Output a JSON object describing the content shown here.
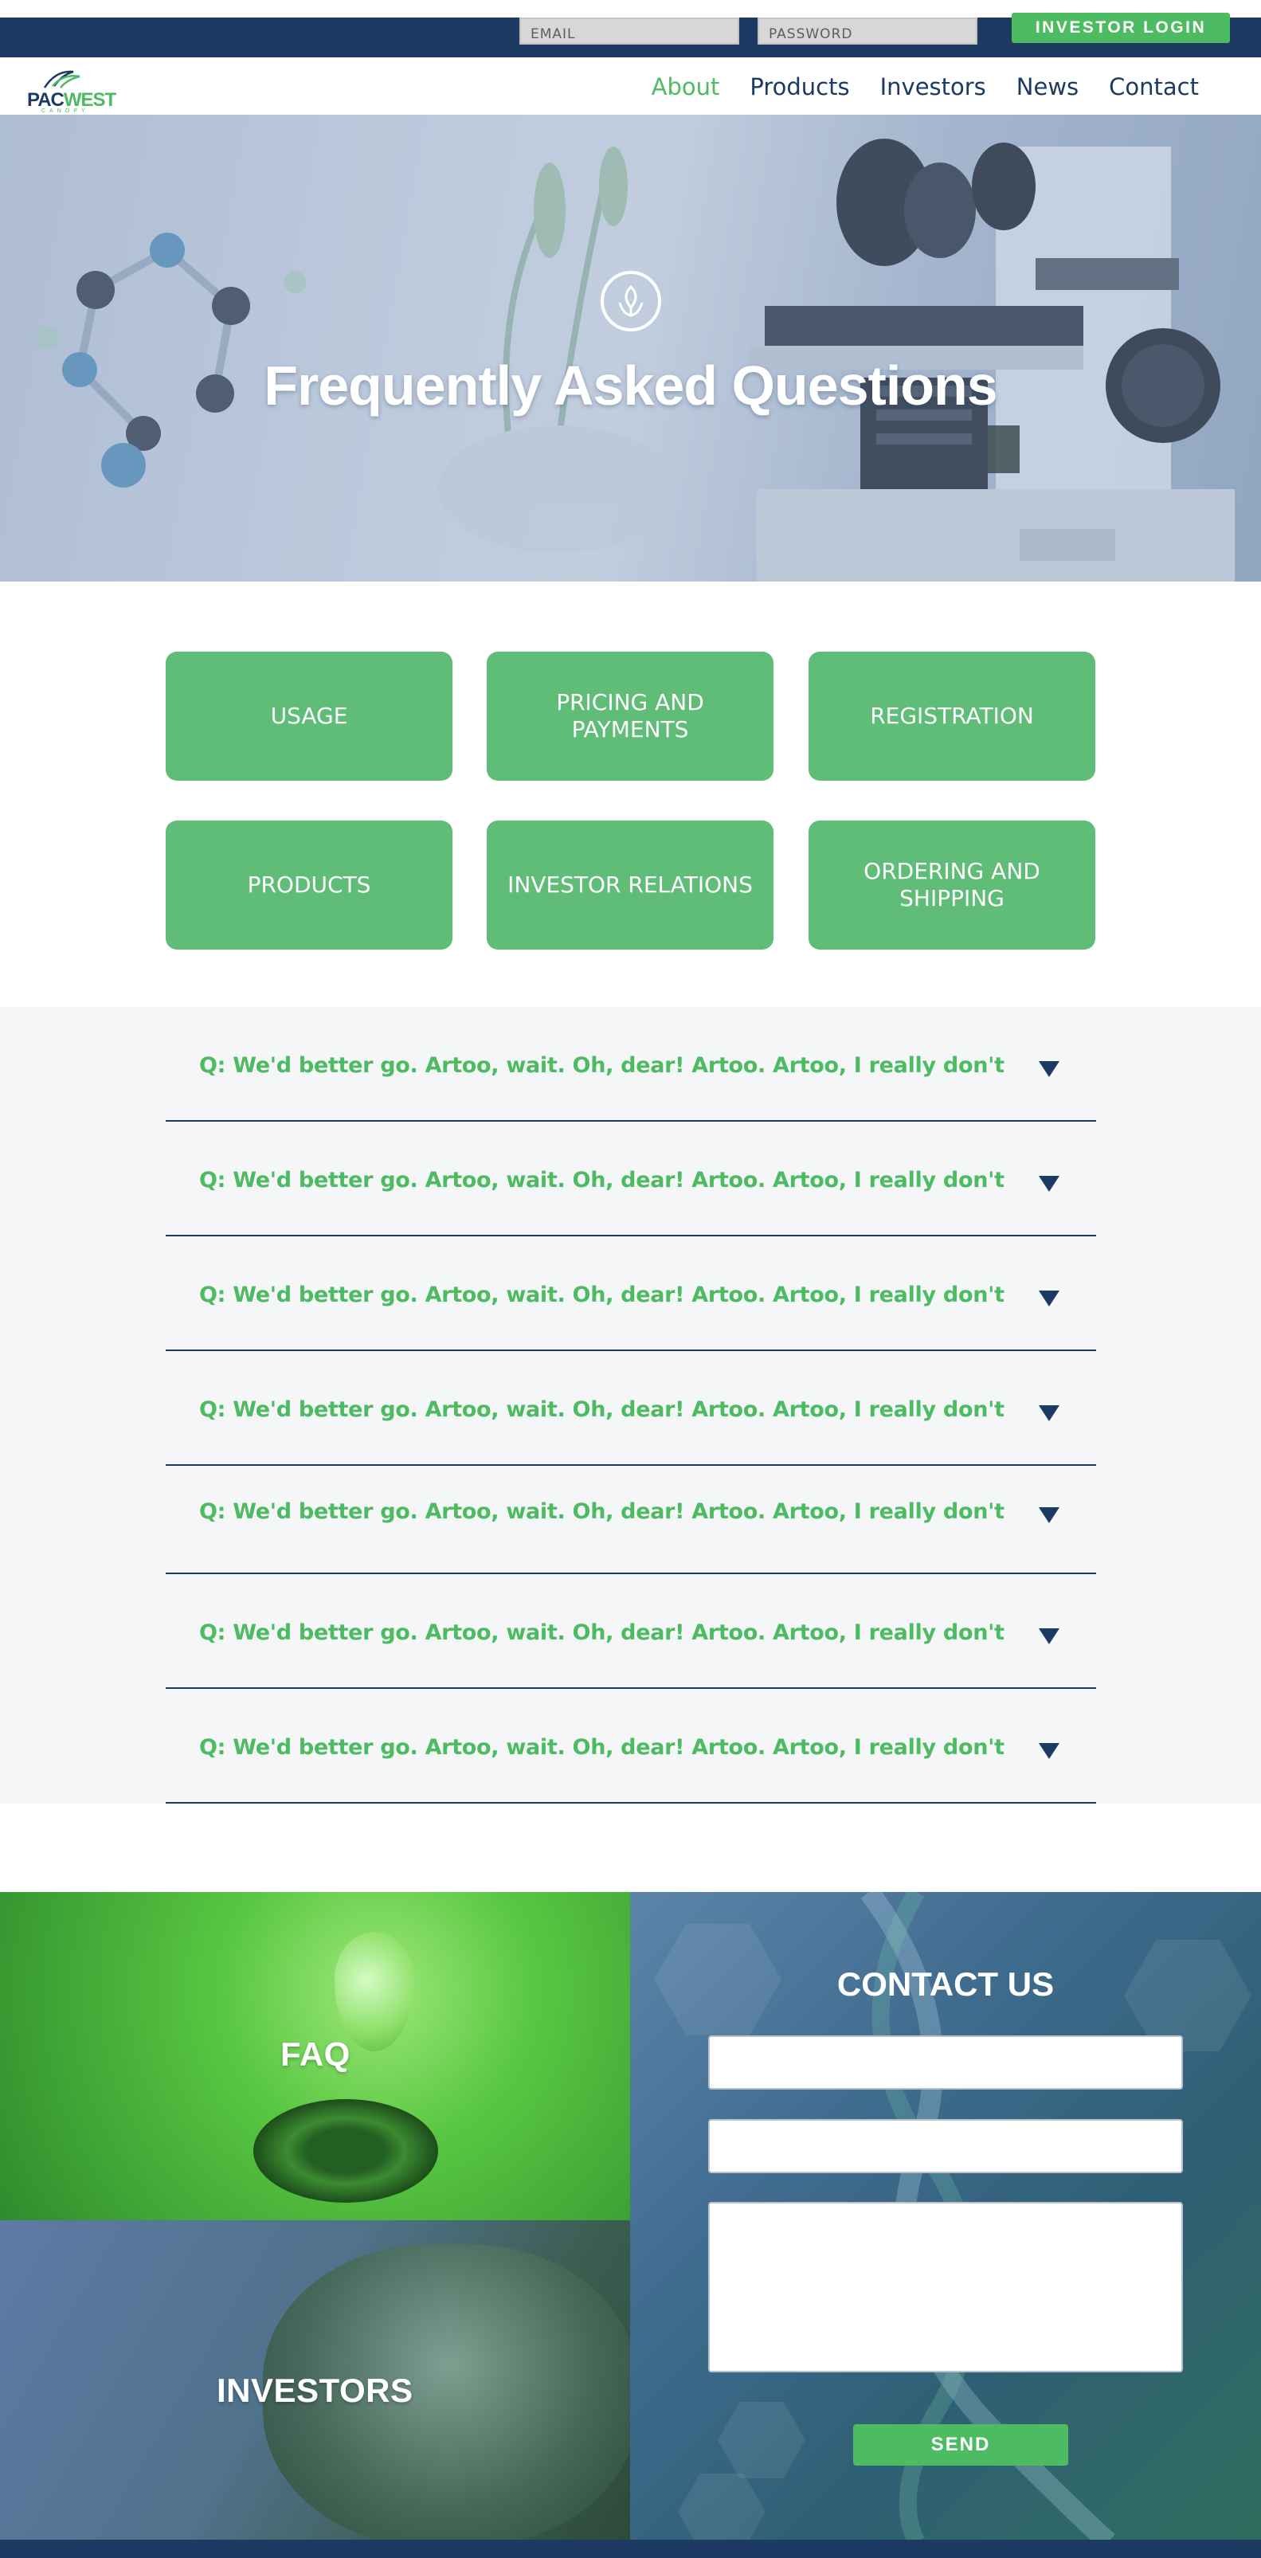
{
  "topbar": {
    "email_placeholder": "EMAIL",
    "password_placeholder": "PASSWORD",
    "login_label": "INVESTOR LOGIN"
  },
  "brand": {
    "logo_pac": "PAC",
    "logo_west": "WEST",
    "logo_sub": "CANOPY"
  },
  "nav": {
    "items": [
      {
        "label": "About",
        "active": true
      },
      {
        "label": "Products",
        "active": false
      },
      {
        "label": "Investors",
        "active": false
      },
      {
        "label": "News",
        "active": false
      },
      {
        "label": "Contact",
        "active": false
      }
    ]
  },
  "hero": {
    "title": "Frequently Asked Questions",
    "icon": "leaf-icon"
  },
  "categories": [
    "USAGE",
    "PRICING AND PAYMENTS",
    "REGISTRATION",
    "PRODUCTS",
    "INVESTOR RELATIONS",
    "ORDERING AND SHIPPING"
  ],
  "faq": {
    "items": [
      "Q: We'd better go. Artoo, wait. Oh, dear! Artoo. Artoo, I really don't",
      "Q: We'd better go. Artoo, wait. Oh, dear! Artoo. Artoo, I really don't",
      "Q: We'd better go. Artoo, wait. Oh, dear! Artoo. Artoo, I really don't",
      "Q: We'd better go. Artoo, wait. Oh, dear! Artoo. Artoo, I really don't",
      "Q: We'd better go. Artoo, wait. Oh, dear! Artoo. Artoo, I really don't",
      "Q: We'd better go. Artoo, wait. Oh, dear! Artoo. Artoo, I really don't",
      "Q: We'd better go. Artoo, wait. Oh, dear! Artoo. Artoo, I really don't"
    ],
    "arrow_icon": "caret-down-icon"
  },
  "tiles": {
    "faq_label": "FAQ",
    "investors_label": "INVESTORS"
  },
  "contact": {
    "title": "CONTACT US",
    "send_label": "SEND"
  },
  "colors": {
    "navy": "#1c3a62",
    "green": "#4dbb62",
    "category_green": "#5fbd78",
    "faq_bg": "#f5f6f7"
  }
}
